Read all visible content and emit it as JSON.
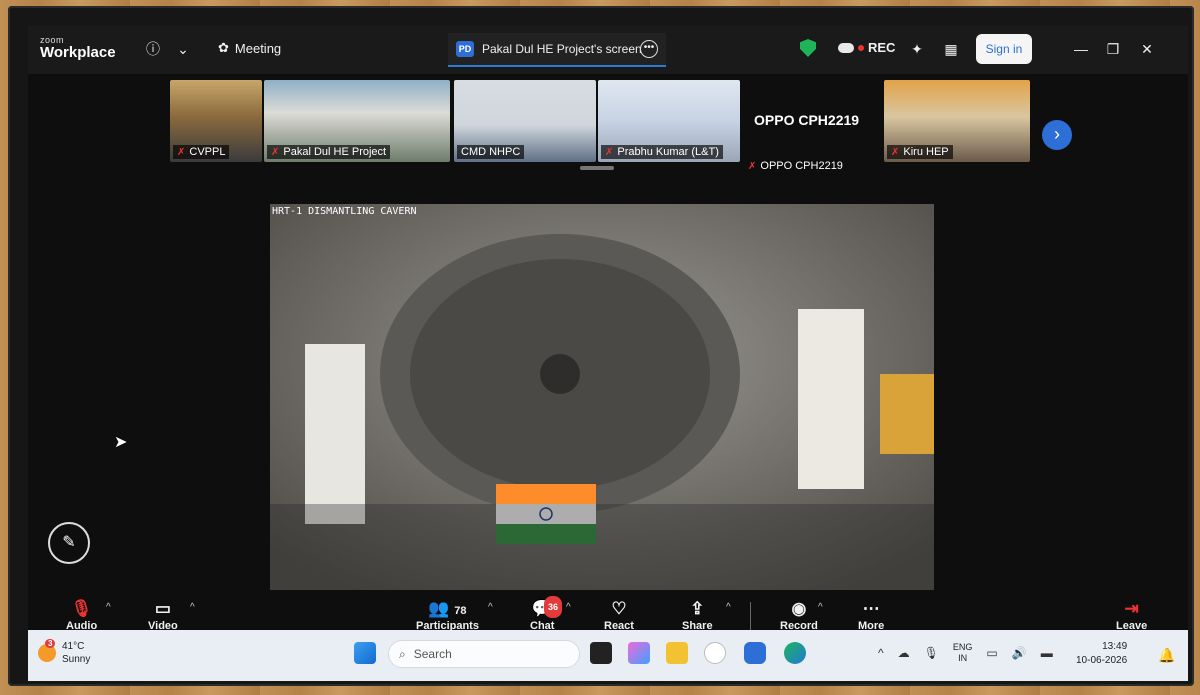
{
  "topbar": {
    "brand_small": "zoom",
    "brand_big": "Workplace",
    "meeting_label": "Meeting",
    "share_badge": "PD",
    "share_title": "Pakal Dul HE Project's screen",
    "rec_label": "REC",
    "signin_label": "Sign in"
  },
  "gallery": {
    "tiles": [
      {
        "label": "CVPPL"
      },
      {
        "label": "Pakal Dul HE Project"
      },
      {
        "label": "CMD NHPC"
      },
      {
        "label": "Prabhu Kumar (L&T)"
      },
      {
        "label": "OPPO CPH2219"
      },
      {
        "label": "Kiru HEP"
      }
    ],
    "oppo_name": "OPPO CPH2219"
  },
  "share": {
    "caption": "HRT-1 DISMANTLING CAVERN"
  },
  "toolbar": {
    "audio": "Audio",
    "video": "Video",
    "participants": "Participants",
    "participants_count": "78",
    "chat": "Chat",
    "chat_badge": "36",
    "react": "React",
    "share": "Share",
    "record": "Record",
    "more": "More",
    "leave": "Leave"
  },
  "taskbar": {
    "weather_badge": "3",
    "temperature": "41°C",
    "condition": "Sunny",
    "search_placeholder": "Search",
    "lang_top": "ENG",
    "lang_bottom": "IN",
    "time": "13:49",
    "date": "10-06-2026"
  },
  "colors": {
    "accent": "#2d6fd6",
    "rec_dot": "#e33b3b",
    "shield": "#20b45a"
  }
}
